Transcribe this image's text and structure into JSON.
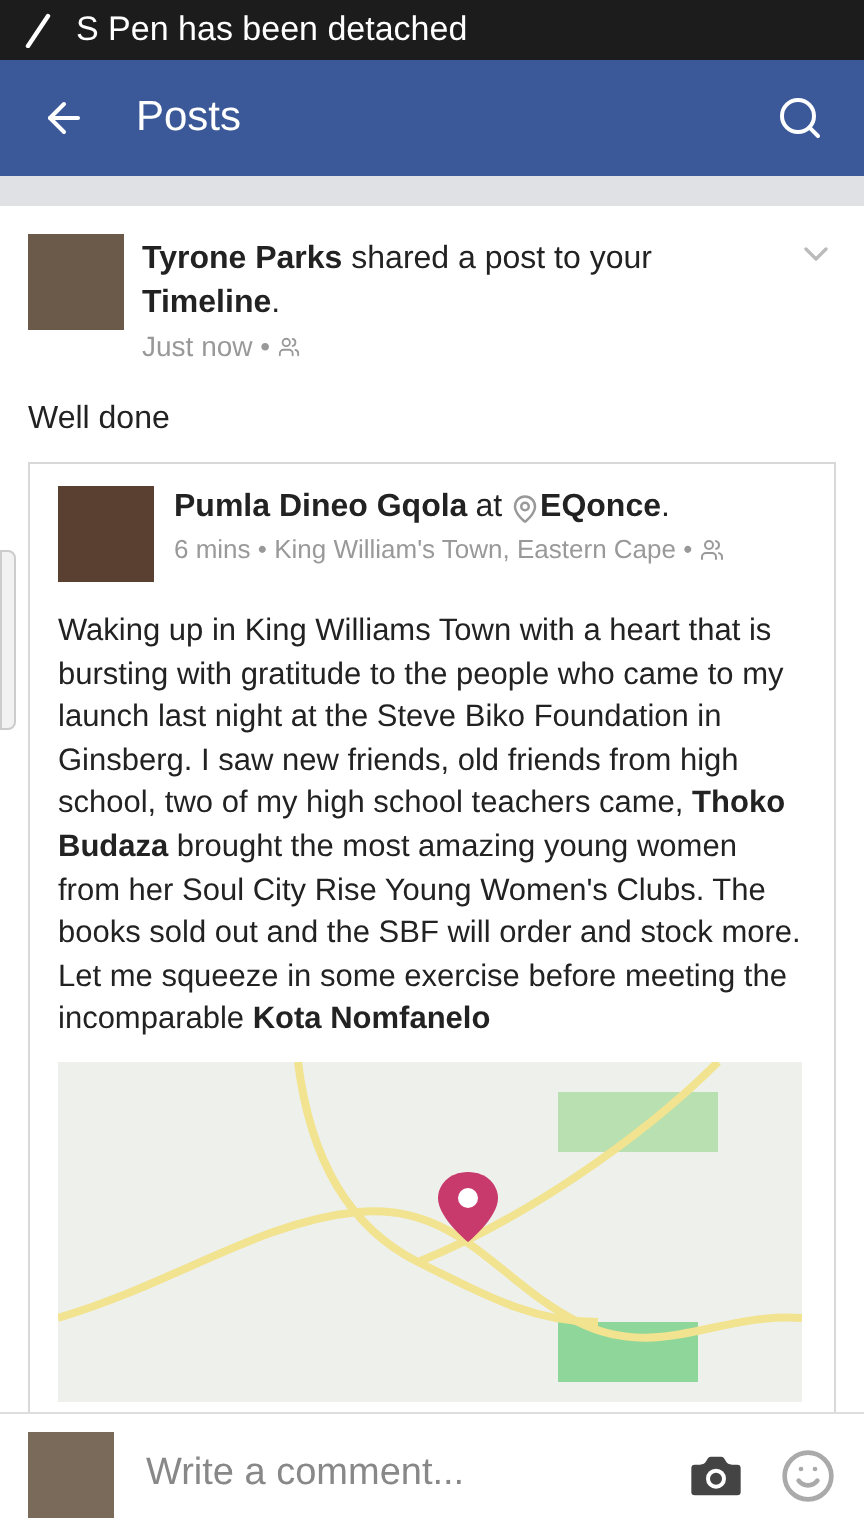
{
  "status_bar": {
    "notification": "S Pen has been detached"
  },
  "app_bar": {
    "title": "Posts"
  },
  "post": {
    "text": "**Tyrone Parks** shared a post to your **Timeline**.",
    "time": "Just now •",
    "caption": "Well done",
    "shared": {
      "author": "Pumla Dineo Gqola",
      "at": "at",
      "place": "EQonce",
      "place_end": ".",
      "meta": "6 mins • King William's Town, Eastern Cape •",
      "body": "Waking up in King Williams Town with a heart that is bursting with gratitude to the people who came to my launch last night at the Steve Biko Foundation in Ginsberg. I saw new friends, old friends from high school, two of my high school teachers came, **Thoko Budaza** brought the most amazing young women from her Soul City Rise Young Women's Clubs. The books sold out and the SBF will order and stock more. Let me squeeze in some exercise before meeting the incomparable **Kota Nomfanelo**"
    }
  },
  "comment_bar": {
    "placeholder": "Write a comment..."
  }
}
